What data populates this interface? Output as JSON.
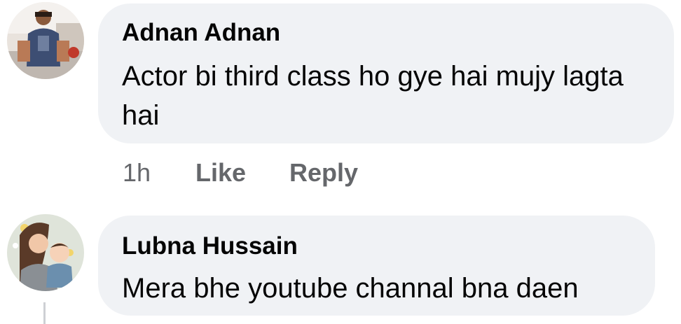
{
  "comments": [
    {
      "author": "Adnan Adnan",
      "text": "Actor bi third class ho gye hai mujy lagta hai",
      "time": "1h",
      "like_label": "Like",
      "reply_label": "Reply"
    },
    {
      "author": "Lubna Hussain",
      "text": "Mera bhe youtube channal bna daen"
    }
  ],
  "colors": {
    "bubble_bg": "#f0f2f5",
    "text": "#050505",
    "secondary_text": "#65676b"
  }
}
